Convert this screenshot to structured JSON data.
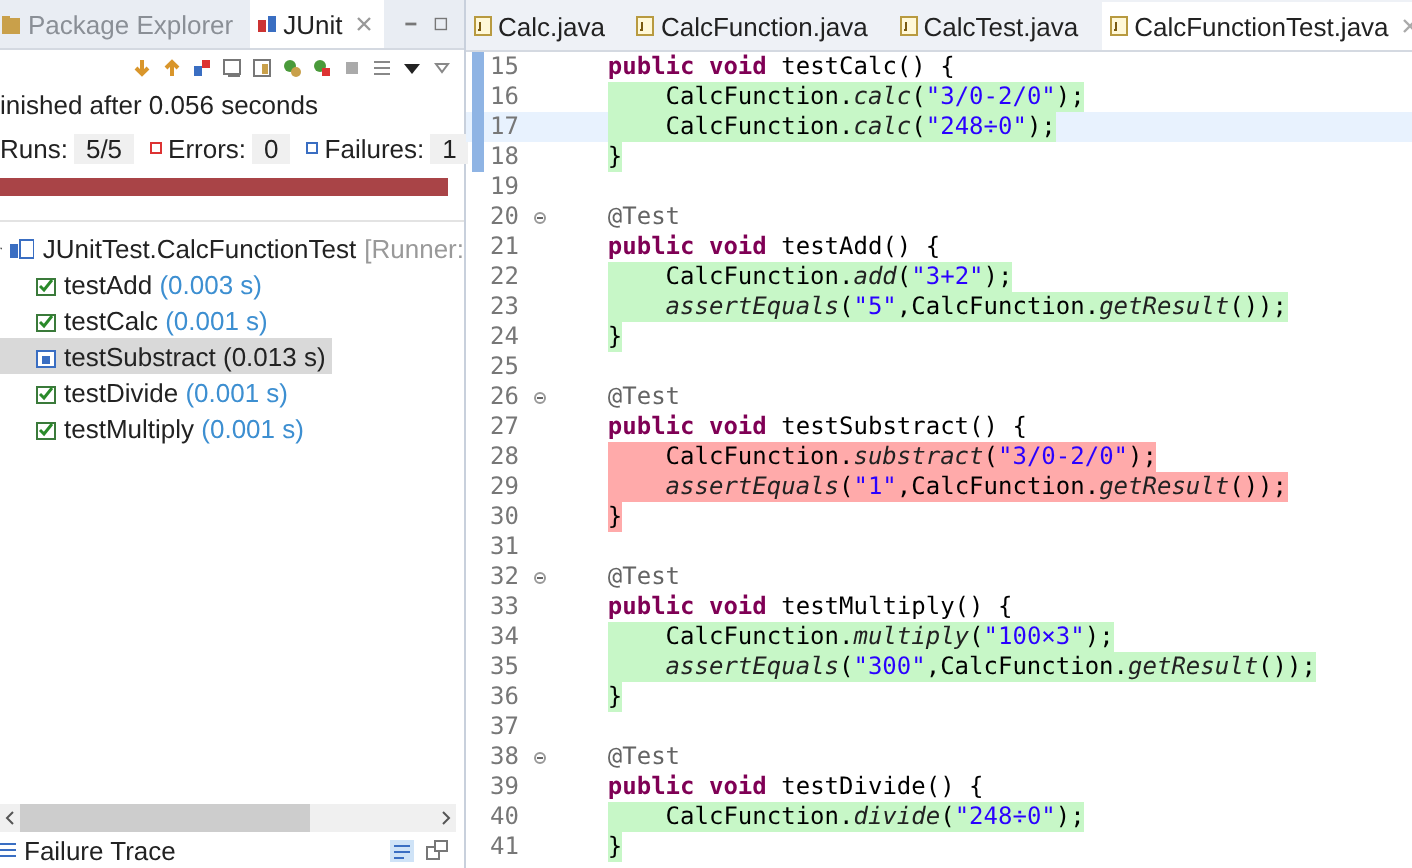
{
  "left_panel": {
    "tabs": [
      {
        "label": "Package Explorer",
        "selected": false
      },
      {
        "label": "JUnit",
        "selected": true
      }
    ],
    "status": "inished after 0.056 seconds",
    "counters": [
      {
        "label": "Runs:",
        "value": "5/5",
        "kind": "runs"
      },
      {
        "label": "Errors:",
        "value": "0",
        "kind": "errors"
      },
      {
        "label": "Failures:",
        "value": "1",
        "kind": "failures"
      }
    ],
    "progress": {
      "level": 1,
      "failed": true
    },
    "tree": {
      "label": "JUnitTest.CalcFunctionTest",
      "runner": "[Runner:",
      "expanded": true,
      "children": [
        {
          "name": "testAdd",
          "time": "(0.003 s)",
          "kind": "passed",
          "selected": false
        },
        {
          "name": "testCalc",
          "time": "(0.001 s)",
          "kind": "passed",
          "selected": false
        },
        {
          "name": "testSubstract",
          "time": "(0.013 s)",
          "kind": "failed",
          "selected": true
        },
        {
          "name": "testDivide",
          "time": "(0.001 s)",
          "kind": "passed",
          "selected": false
        },
        {
          "name": "testMultiply",
          "time": "(0.001 s)",
          "kind": "passed",
          "selected": false
        }
      ]
    },
    "failure_trace": {
      "label": "Failure Trace"
    }
  },
  "editor": {
    "tabs": [
      {
        "label": "Calc.java",
        "selected": false
      },
      {
        "label": "CalcFunction.java",
        "selected": false
      },
      {
        "label": "CalcTest.java",
        "selected": false
      },
      {
        "label": "CalcFunctionTest.java",
        "selected": true
      }
    ],
    "lines": [
      {
        "number": "15",
        "marked": true,
        "fold": false,
        "current": false,
        "covered": false,
        "failed": false,
        "tokens": [
          {
            "text": "    public void",
            "kind": "keyword"
          },
          {
            "text": " testCalc() {",
            "kind": "plain"
          }
        ]
      },
      {
        "number": "16",
        "marked": true,
        "fold": false,
        "current": false,
        "covered": true,
        "failed": false,
        "tokens": [
          {
            "text": "        CalcFunction.",
            "kind": "plain"
          },
          {
            "text": "calc",
            "kind": "call"
          },
          {
            "text": "(",
            "kind": "plain"
          },
          {
            "text": "\"3/0-2/0\"",
            "kind": "string"
          },
          {
            "text": ");",
            "kind": "plain"
          }
        ]
      },
      {
        "number": "17",
        "marked": true,
        "fold": false,
        "current": true,
        "covered": true,
        "failed": false,
        "tokens": [
          {
            "text": "        CalcFunction.",
            "kind": "plain"
          },
          {
            "text": "calc",
            "kind": "call"
          },
          {
            "text": "(",
            "kind": "plain"
          },
          {
            "text": "\"248÷0\"",
            "kind": "string"
          },
          {
            "text": ");",
            "kind": "plain"
          }
        ]
      },
      {
        "number": "18",
        "marked": true,
        "fold": false,
        "current": false,
        "covered": true,
        "failed": false,
        "tokens": [
          {
            "text": "    }",
            "kind": "plain"
          }
        ]
      },
      {
        "number": "19",
        "marked": false,
        "fold": false,
        "current": false
      },
      {
        "number": "20",
        "marked": false,
        "fold": true,
        "current": false,
        "covered": false,
        "failed": false,
        "tokens": [
          {
            "text": "    @Test",
            "kind": "annotation"
          }
        ]
      },
      {
        "number": "21",
        "marked": false,
        "fold": false,
        "current": false,
        "covered": false,
        "failed": false,
        "tokens": [
          {
            "text": "    public void",
            "kind": "keyword"
          },
          {
            "text": " testAdd() {",
            "kind": "plain"
          }
        ]
      },
      {
        "number": "22",
        "marked": false,
        "fold": false,
        "current": false,
        "covered": true,
        "failed": false,
        "tokens": [
          {
            "text": "        CalcFunction.",
            "kind": "plain"
          },
          {
            "text": "add",
            "kind": "call"
          },
          {
            "text": "(",
            "kind": "plain"
          },
          {
            "text": "\"3+2\"",
            "kind": "string"
          },
          {
            "text": ");",
            "kind": "plain"
          }
        ]
      },
      {
        "number": "23",
        "marked": false,
        "fold": false,
        "current": false,
        "covered": true,
        "failed": false,
        "tokens": [
          {
            "text": "        assertEquals",
            "kind": "call"
          },
          {
            "text": "(",
            "kind": "plain"
          },
          {
            "text": "\"5\"",
            "kind": "string"
          },
          {
            "text": ",CalcFunction.",
            "kind": "plain"
          },
          {
            "text": "getResult",
            "kind": "call"
          },
          {
            "text": "());",
            "kind": "plain"
          }
        ]
      },
      {
        "number": "24",
        "marked": false,
        "fold": false,
        "current": false,
        "covered": true,
        "failed": false,
        "tokens": [
          {
            "text": "    }",
            "kind": "plain"
          }
        ]
      },
      {
        "number": "25",
        "marked": false,
        "fold": false,
        "current": false
      },
      {
        "number": "26",
        "marked": false,
        "fold": true,
        "current": false,
        "covered": false,
        "failed": false,
        "tokens": [
          {
            "text": "    @Test",
            "kind": "annotation"
          }
        ]
      },
      {
        "number": "27",
        "marked": false,
        "fold": false,
        "current": false,
        "covered": false,
        "failed": false,
        "tokens": [
          {
            "text": "    public void",
            "kind": "keyword"
          },
          {
            "text": " testSubstract() {",
            "kind": "plain"
          }
        ]
      },
      {
        "number": "28",
        "marked": false,
        "fold": false,
        "current": false,
        "covered": false,
        "failed": true,
        "tokens": [
          {
            "text": "        CalcFunction.",
            "kind": "plain"
          },
          {
            "text": "substract",
            "kind": "call"
          },
          {
            "text": "(",
            "kind": "plain"
          },
          {
            "text": "\"3/0-2/0\"",
            "kind": "string"
          },
          {
            "text": ");",
            "kind": "plain"
          }
        ]
      },
      {
        "number": "29",
        "marked": false,
        "fold": false,
        "current": false,
        "covered": false,
        "failed": true,
        "tokens": [
          {
            "text": "        assertEquals",
            "kind": "call"
          },
          {
            "text": "(",
            "kind": "plain"
          },
          {
            "text": "\"1\"",
            "kind": "string"
          },
          {
            "text": ",CalcFunction.",
            "kind": "plain"
          },
          {
            "text": "getResult",
            "kind": "call"
          },
          {
            "text": "());",
            "kind": "plain"
          }
        ]
      },
      {
        "number": "30",
        "marked": false,
        "fold": false,
        "current": false,
        "covered": false,
        "failed": true,
        "tokens": [
          {
            "text": "    }",
            "kind": "plain"
          }
        ]
      },
      {
        "number": "31",
        "marked": false,
        "fold": false,
        "current": false
      },
      {
        "number": "32",
        "marked": false,
        "fold": true,
        "current": false,
        "covered": false,
        "failed": false,
        "tokens": [
          {
            "text": "    @Test",
            "kind": "annotation"
          }
        ]
      },
      {
        "number": "33",
        "marked": false,
        "fold": false,
        "current": false,
        "covered": false,
        "failed": false,
        "tokens": [
          {
            "text": "    public void",
            "kind": "keyword"
          },
          {
            "text": " testMultiply() {",
            "kind": "plain"
          }
        ]
      },
      {
        "number": "34",
        "marked": false,
        "fold": false,
        "current": false,
        "covered": true,
        "failed": false,
        "tokens": [
          {
            "text": "        CalcFunction.",
            "kind": "plain"
          },
          {
            "text": "multiply",
            "kind": "call"
          },
          {
            "text": "(",
            "kind": "plain"
          },
          {
            "text": "\"100×3\"",
            "kind": "string"
          },
          {
            "text": ");",
            "kind": "plain"
          }
        ]
      },
      {
        "number": "35",
        "marked": false,
        "fold": false,
        "current": false,
        "covered": true,
        "failed": false,
        "tokens": [
          {
            "text": "        assertEquals",
            "kind": "call"
          },
          {
            "text": "(",
            "kind": "plain"
          },
          {
            "text": "\"300\"",
            "kind": "string"
          },
          {
            "text": ",CalcFunction.",
            "kind": "plain"
          },
          {
            "text": "getResult",
            "kind": "call"
          },
          {
            "text": "());",
            "kind": "plain"
          }
        ]
      },
      {
        "number": "36",
        "marked": false,
        "fold": false,
        "current": false,
        "covered": true,
        "failed": false,
        "tokens": [
          {
            "text": "    }",
            "kind": "plain"
          }
        ]
      },
      {
        "number": "37",
        "marked": false,
        "fold": false,
        "current": false
      },
      {
        "number": "38",
        "marked": false,
        "fold": true,
        "current": false,
        "covered": false,
        "failed": false,
        "tokens": [
          {
            "text": "    @Test",
            "kind": "annotation"
          }
        ]
      },
      {
        "number": "39",
        "marked": false,
        "fold": false,
        "current": false,
        "covered": false,
        "failed": false,
        "tokens": [
          {
            "text": "    public void",
            "kind": "keyword"
          },
          {
            "text": " testDivide() {",
            "kind": "plain"
          }
        ]
      },
      {
        "number": "40",
        "marked": false,
        "fold": false,
        "current": false,
        "covered": true,
        "failed": false,
        "tokens": [
          {
            "text": "        CalcFunction.",
            "kind": "plain"
          },
          {
            "text": "divide",
            "kind": "call"
          },
          {
            "text": "(",
            "kind": "plain"
          },
          {
            "text": "\"248÷0\"",
            "kind": "string"
          },
          {
            "text": ");",
            "kind": "plain"
          }
        ]
      },
      {
        "number": "41",
        "marked": false,
        "fold": false,
        "current": false,
        "covered": true,
        "failed": false,
        "tokens": [
          {
            "text": "    }",
            "kind": "plain"
          }
        ]
      }
    ]
  }
}
